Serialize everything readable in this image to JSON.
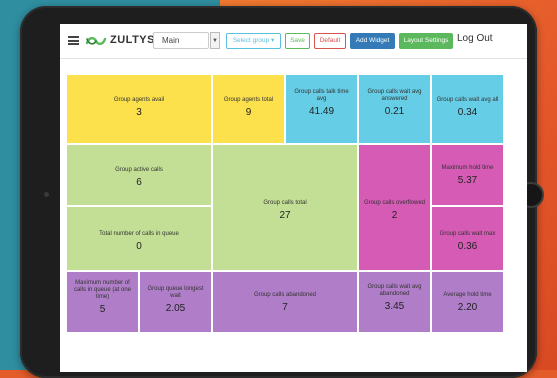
{
  "colors": {
    "yellow": "#fce04c",
    "teal": "#66cde6",
    "green": "#c3df95",
    "magenta": "#d65bb5",
    "purple": "#b07ec8"
  },
  "header": {
    "logo_text": "ZULTYS",
    "dashboard_select": "Main",
    "select_group": "Select group ▾",
    "save": "Save",
    "default": "Default",
    "add_widget": "Add Widget",
    "layout_settings": "Layout Settings",
    "logout": "Log Out"
  },
  "tiles": [
    {
      "label": "Group agents avail",
      "value": "3"
    },
    {
      "label": "Group agents total",
      "value": "9"
    },
    {
      "label": "Group calls talk time avg",
      "value": "41.49"
    },
    {
      "label": "Group calls wait avg answered",
      "value": "0.21"
    },
    {
      "label": "Group calls wait avg all",
      "value": "0.34"
    },
    {
      "label": "Group active calls",
      "value": "6"
    },
    {
      "label": "Group calls total",
      "value": "27"
    },
    {
      "label": "Group calls overflowed",
      "value": "2"
    },
    {
      "label": "Maximum hold time",
      "value": "5.37"
    },
    {
      "label": "Total number of calls in queue",
      "value": "0"
    },
    {
      "label": "Group calls wait max",
      "value": "0.36"
    },
    {
      "label": "Maximum number of calls in queue (at one time)",
      "value": "5"
    },
    {
      "label": "Group queue longest wait",
      "value": "2.05"
    },
    {
      "label": "Group calls abandoned",
      "value": "7"
    },
    {
      "label": "Group calls wait avg abandoned",
      "value": "3.45"
    },
    {
      "label": "Average hold time",
      "value": "2.20"
    }
  ]
}
